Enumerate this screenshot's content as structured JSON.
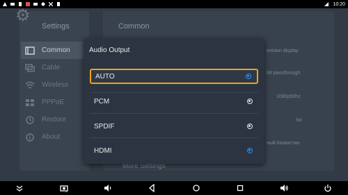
{
  "status_bar": {
    "time": "10:20",
    "left_icons": [
      "alert-icon",
      "image-icon",
      "notification-icon",
      "sim-icon",
      "photo-icon",
      "tools-icon",
      "x-icon",
      "clipboard-icon"
    ]
  },
  "settings": {
    "title": "Settings",
    "nav": [
      {
        "label": "Common",
        "icon": "common-icon"
      },
      {
        "label": "Cable",
        "icon": "cable-icon"
      },
      {
        "label": "Wireless",
        "icon": "wifi-icon"
      },
      {
        "label": "PPPoE",
        "icon": "pppoe-icon"
      },
      {
        "label": "Restore",
        "icon": "restore-icon"
      },
      {
        "label": "About",
        "icon": "about-icon"
      }
    ],
    "section_title": "Common",
    "values": [
      "evision display",
      "MI passthrough",
      "1080p50hz",
      "No",
      "ный Казахстан"
    ],
    "more_settings": "More Settings"
  },
  "dialog": {
    "title": "Audio Output",
    "options": [
      {
        "label": "AUTO",
        "selected": true,
        "focused": true
      },
      {
        "label": "PCM",
        "selected": false
      },
      {
        "label": "SPDIF",
        "selected": false
      },
      {
        "label": "HDMI",
        "selected": true
      }
    ],
    "focus_color": "#f0a31a",
    "selected_color": "#2f8ff0"
  },
  "nav_bar": {
    "buttons": [
      "collapse-icon",
      "screenshot-icon",
      "volume-down-icon",
      "back-icon",
      "home-icon",
      "recents-icon",
      "volume-up-icon",
      "power-icon"
    ]
  }
}
